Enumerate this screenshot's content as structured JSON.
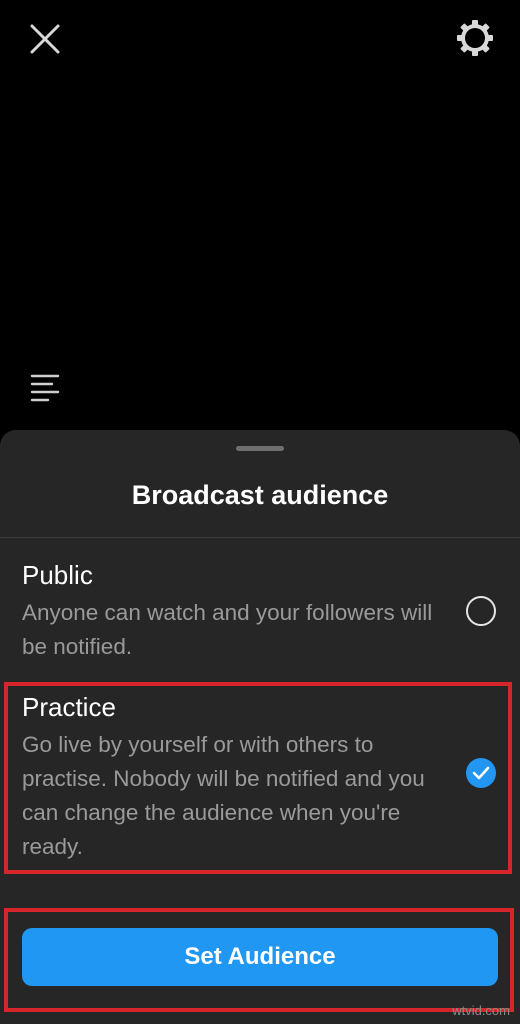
{
  "top_bar": {
    "close_icon": "close-icon",
    "settings_icon": "gear-icon"
  },
  "side": {
    "menu_icon": "menu-icon"
  },
  "sheet": {
    "title": "Broadcast audience",
    "options": [
      {
        "title": "Public",
        "description": "Anyone can watch and your followers will be notified.",
        "selected": false
      },
      {
        "title": "Practice",
        "description": "Go live by yourself or with others to practise. Nobody will be notified and you can change the audience when you're ready.",
        "selected": true
      }
    ],
    "button_label": "Set Audience"
  },
  "colors": {
    "accent": "#1f97f3",
    "highlight": "#d6262b",
    "sheet_bg": "#262626"
  },
  "watermark": "wtvid.com"
}
